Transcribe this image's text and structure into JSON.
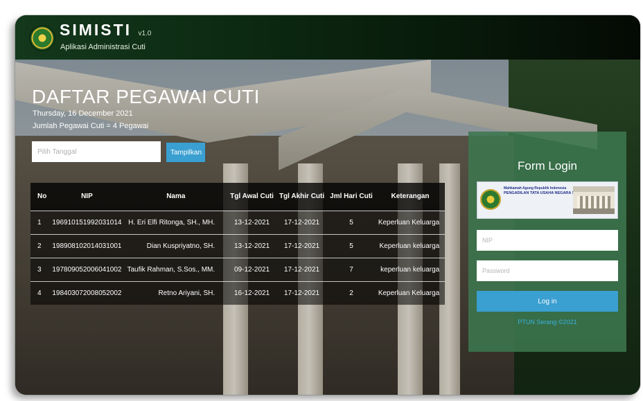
{
  "header": {
    "app_name": "SIMISTI",
    "version": "v1.0",
    "subtitle": "Aplikasi Administrasi Cuti"
  },
  "main": {
    "title": "DAFTAR PEGAWAI CUTI",
    "date": "Thursday, 16 December 2021",
    "count": "Jumlah Pegawai Cuti = 4 Pegawai",
    "date_placeholder": "Pilih Tanggal",
    "show_button": "Tampilkan"
  },
  "table": {
    "columns": [
      "No",
      "NIP",
      "Nama",
      "Tgl Awal Cuti",
      "Tgl Akhir Cuti",
      "Jml Hari Cuti",
      "Keterangan"
    ],
    "rows": [
      [
        "1",
        "196910151992031014",
        "H. Eri Elfi Ritonga, SH., MH.",
        "13-12-2021",
        "17-12-2021",
        "5",
        "Keperluan Keluarga"
      ],
      [
        "2",
        "198908102014031001",
        "Dian Kuspriyatno, SH.",
        "13-12-2021",
        "17-12-2021",
        "5",
        "Keperluan keluarga"
      ],
      [
        "3",
        "197809052006041002",
        "Taufik Rahman, S.Sos., MM.",
        "09-12-2021",
        "17-12-2021",
        "7",
        "keperluan keluarga"
      ],
      [
        "4",
        "198403072008052002",
        "Retno Ariyani, SH.",
        "16-12-2021",
        "17-12-2021",
        "2",
        "Keperluan Keluarga"
      ]
    ]
  },
  "login": {
    "title": "Form Login",
    "banner_line1": "Mahkamah Agung Republik Indonesia",
    "banner_line2": "PENGADILAN TATA USAHA NEGARA SERANG",
    "nip_placeholder": "NIP",
    "password_placeholder": "Password",
    "button": "Log in",
    "footer": "PTUN Serang ©2021"
  },
  "colors": {
    "header_bg": "#0c2a12",
    "accent_blue": "#3a9fd1",
    "login_panel": "#3c764e",
    "footer_text": "#3bb3e0"
  }
}
